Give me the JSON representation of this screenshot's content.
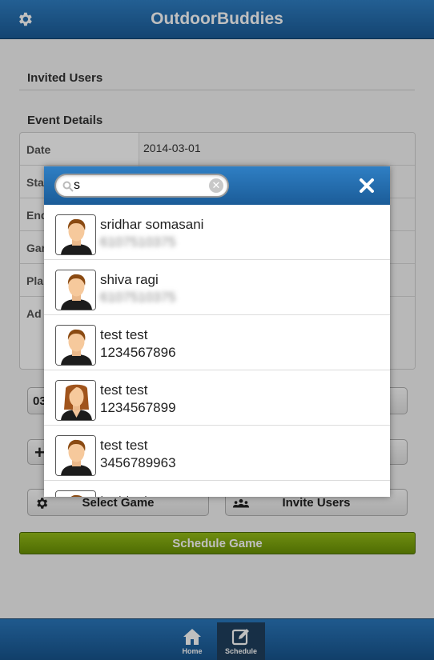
{
  "app": {
    "title": "OutdoorBuddies"
  },
  "sections": {
    "invited_users": "Invited Users",
    "event_details": "Event Details"
  },
  "form": {
    "date_label": "Date",
    "date_value": "2014-03-01",
    "start_label": "Sta",
    "end_label": "End",
    "game_label": "Gar",
    "place_label": "Pla",
    "address_label": "Ad"
  },
  "buttons": {
    "time_partial": "03",
    "select_game": "Select Game",
    "invite_users": "Invite Users",
    "schedule_game": "Schedule Game"
  },
  "footer": {
    "home": "Home",
    "schedule": "Schedule"
  },
  "search": {
    "query": "s"
  },
  "results": [
    {
      "name": "sridhar somasani",
      "phone": "6107510375",
      "phone_obscured": true,
      "avatar": "male"
    },
    {
      "name": "shiva ragi",
      "phone": "6107510375",
      "phone_obscured": true,
      "avatar": "male"
    },
    {
      "name": "test test",
      "phone": "1234567896",
      "phone_obscured": false,
      "avatar": "male"
    },
    {
      "name": "test test",
      "phone": "1234567899",
      "phone_obscured": false,
      "avatar": "female"
    },
    {
      "name": "test test",
      "phone": "3456789963",
      "phone_obscured": false,
      "avatar": "male"
    },
    {
      "name": "test test",
      "phone": "",
      "phone_obscured": false,
      "avatar": "male"
    }
  ],
  "colors": {
    "header_blue": "#1b5c98",
    "schedule_green": "#7da80c"
  }
}
